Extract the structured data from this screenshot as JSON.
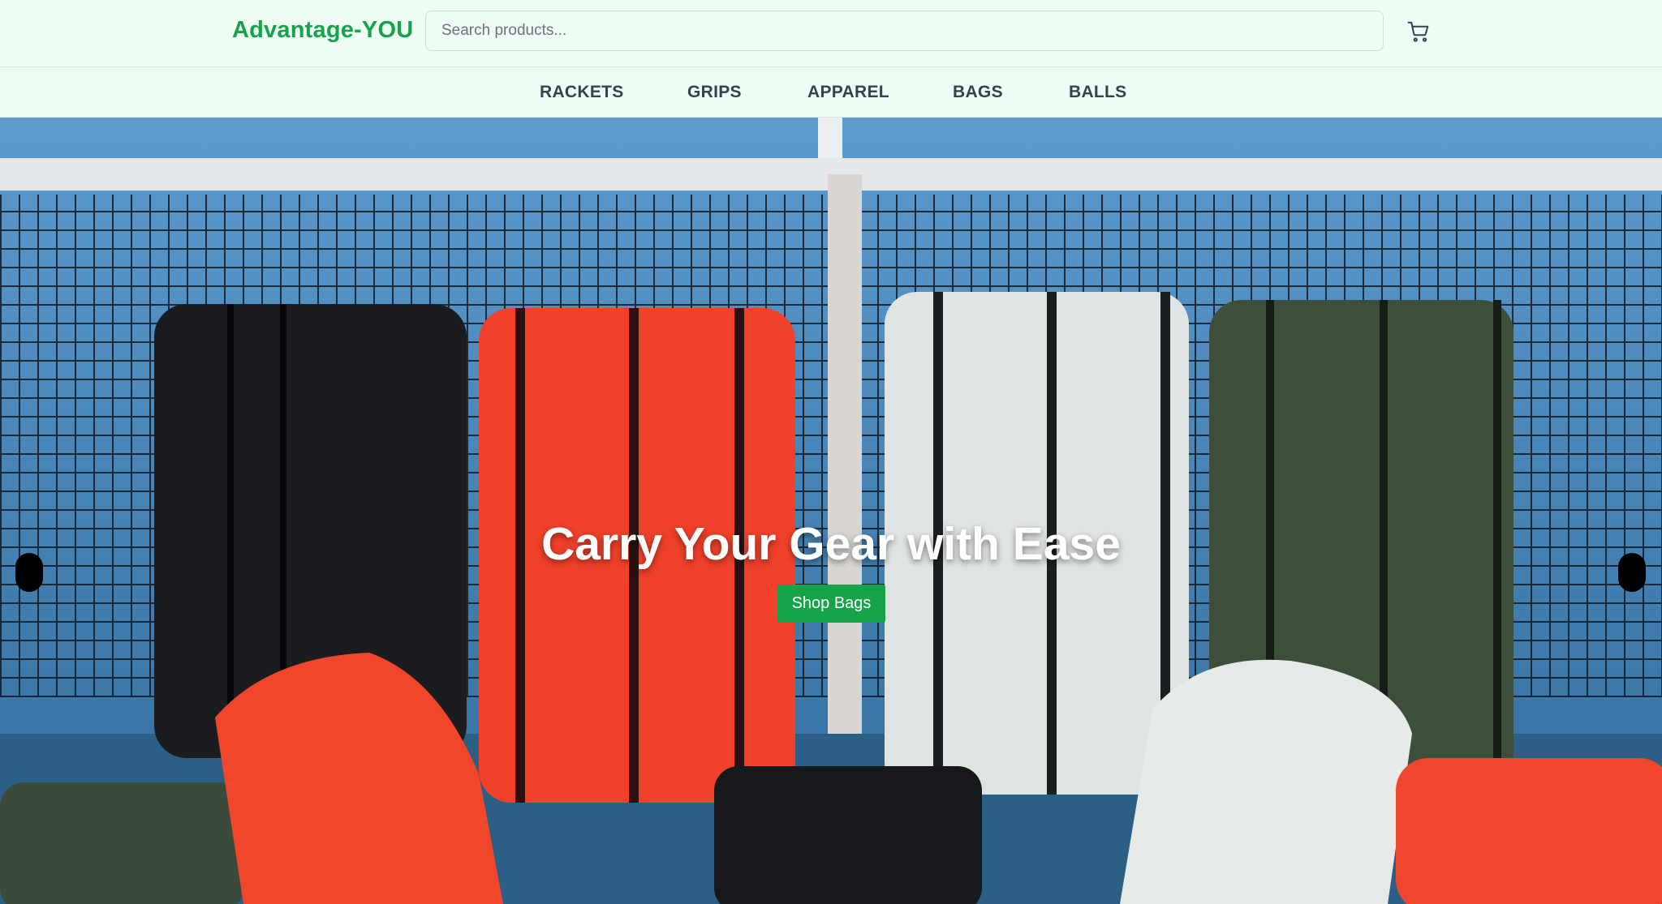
{
  "header": {
    "logo": "Advantage-YOU",
    "search_placeholder": "Search products...",
    "cart_icon": "cart-icon"
  },
  "nav": {
    "items": [
      {
        "label": "RACKETS"
      },
      {
        "label": "GRIPS"
      },
      {
        "label": "APPAREL"
      },
      {
        "label": "BAGS"
      },
      {
        "label": "BALLS"
      }
    ]
  },
  "hero": {
    "title": "Carry Your Gear with Ease",
    "cta_label": "Shop Bags",
    "prev_icon": "carousel-prev-icon",
    "next_icon": "carousel-next-icon"
  },
  "colors": {
    "brand": "#16a34a",
    "background": "#f0fdf4",
    "nav_text": "#374151"
  }
}
